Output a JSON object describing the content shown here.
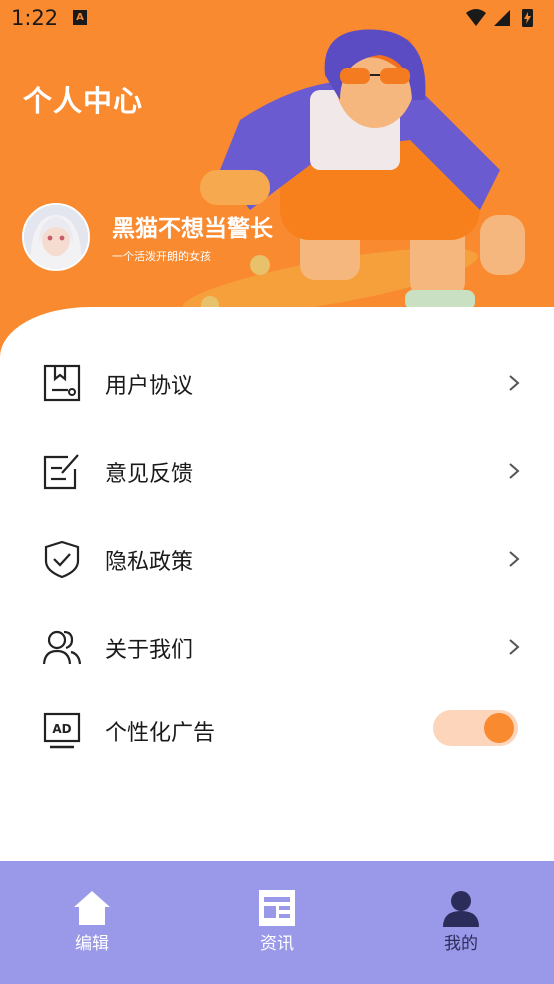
{
  "status_bar": {
    "time": "1:22",
    "app_badge": "A"
  },
  "header": {
    "title": "个人中心"
  },
  "profile": {
    "name": "黑猫不想当警长",
    "bio": "一个活泼开朗的女孩"
  },
  "menu": [
    {
      "label": "用户协议",
      "icon": "agreement-document-icon",
      "type": "link"
    },
    {
      "label": "意见反馈",
      "icon": "feedback-edit-icon",
      "type": "link"
    },
    {
      "label": "隐私政策",
      "icon": "privacy-shield-icon",
      "type": "link"
    },
    {
      "label": "关于我们",
      "icon": "about-users-icon",
      "type": "link"
    },
    {
      "label": "个性化广告",
      "icon": "ad-screen-icon",
      "type": "toggle",
      "enabled": true
    }
  ],
  "bottom_nav": [
    {
      "label": "编辑",
      "icon": "home-icon",
      "active": false
    },
    {
      "label": "资讯",
      "icon": "news-icon",
      "active": false
    },
    {
      "label": "我的",
      "icon": "profile-person-icon",
      "active": true
    }
  ],
  "colors": {
    "accent": "#f98a30",
    "toggle_track": "#fcd5bb",
    "nav_bg": "#9a98e8",
    "nav_active": "#2b2c5a"
  }
}
